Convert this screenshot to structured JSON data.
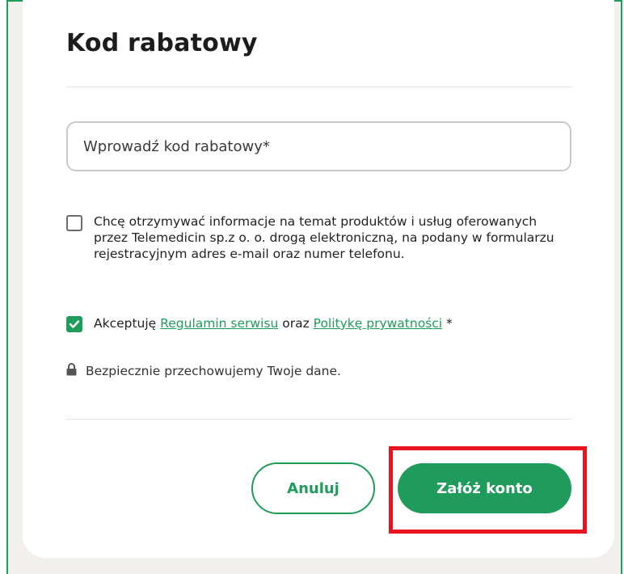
{
  "card": {
    "title": "Kod rabatowy",
    "discount_input": {
      "placeholder": "Wprowadź kod rabatowy*",
      "value": ""
    },
    "marketing_consent": {
      "checked": false,
      "label": "Chcę otrzymywać informacje na temat produktów i usług oferowanych przez Telemedicin sp.z o. o. drogą elektroniczną, na podany w formularzu rejestracyjnym adres e-mail oraz numer telefonu."
    },
    "terms_consent": {
      "checked": true,
      "prefix": "Akceptuję",
      "terms_link": "Regulamin serwisu",
      "conjunction": "oraz",
      "privacy_link": "Politykę prywatności",
      "suffix": "*"
    },
    "security_note": "Bezpiecznie przechowujemy Twoje dane.",
    "buttons": {
      "cancel": "Anuluj",
      "create_account": "Załóż konto"
    }
  },
  "colors": {
    "accent": "#1e9c5a",
    "highlight": "#e8131c",
    "text": "#222222"
  },
  "icons": {
    "lock": "lock-icon",
    "check": "check-icon"
  }
}
